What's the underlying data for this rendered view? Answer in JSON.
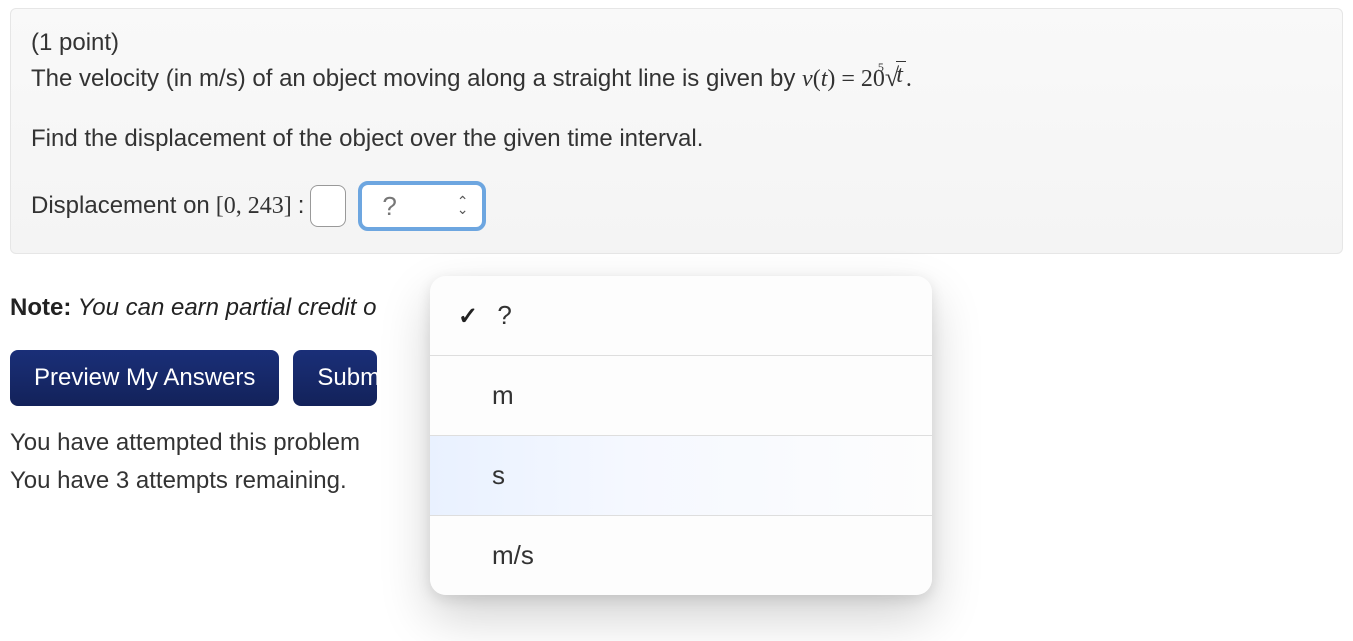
{
  "problem": {
    "points_label": "(1 point)",
    "prompt_prefix": "The velocity (in m/s) of an object moving along a straight line is given by ",
    "equation": {
      "func": "v",
      "paren_open": "(",
      "arg": "t",
      "paren_close": ")",
      "equals": " = ",
      "coeff": "20",
      "root_index": "5",
      "root_arg": "t",
      "period": "."
    },
    "find_text": "Find the displacement of the object over the given time interval.",
    "displacement_label_pre": "Displacement on ",
    "interval": "[0, 243]",
    "colon": ":",
    "answer_value": "",
    "unit_select": {
      "selected": "?",
      "options": [
        "?",
        "m",
        "s",
        "m/s"
      ]
    }
  },
  "note": {
    "label": "Note:",
    "text": " You can earn partial credit o"
  },
  "buttons": {
    "preview": "Preview My Answers",
    "submit": "Submit Answers"
  },
  "status": {
    "attempted": "You have attempted this problem",
    "remaining": "You have 3 attempts remaining."
  }
}
